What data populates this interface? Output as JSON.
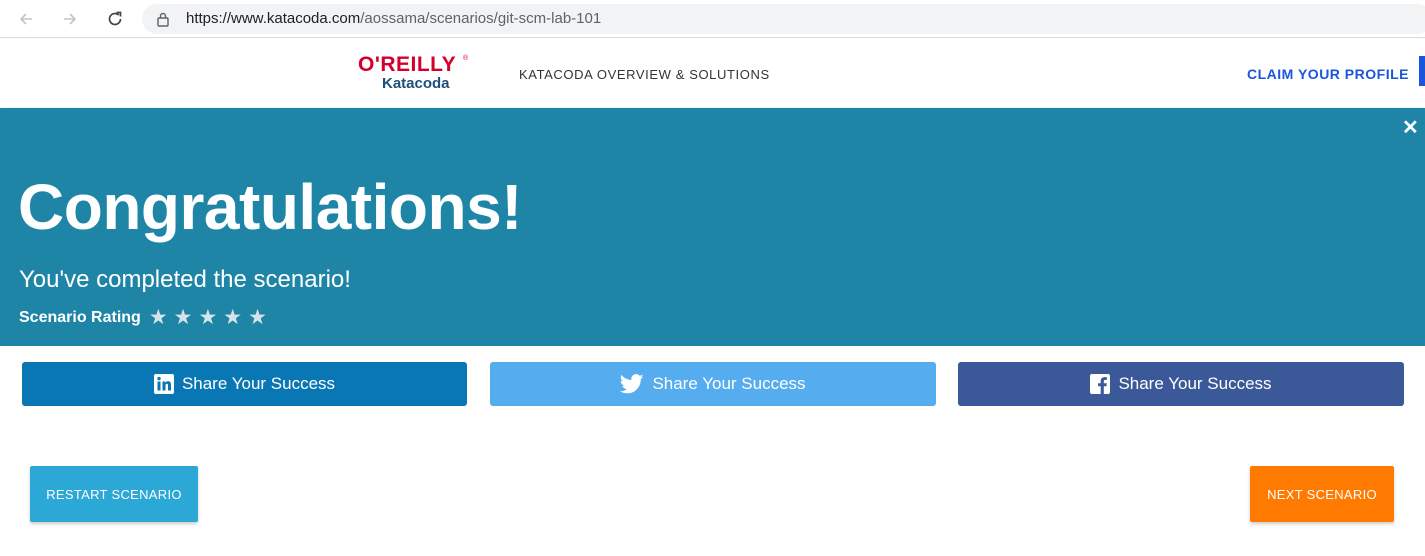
{
  "browser": {
    "url_host": "https://www.katacoda.com",
    "url_path": "/aossama/scenarios/git-scm-lab-101"
  },
  "header": {
    "logo_top": "O'REILLY",
    "logo_reg": "®",
    "logo_bottom": "Katacoda",
    "nav_overview": "KATACODA OVERVIEW & SOLUTIONS",
    "nav_claim": "CLAIM YOUR PROFILE"
  },
  "banner": {
    "close": "✕",
    "title": "Congratulations!",
    "subtitle": "You've completed the scenario!",
    "rating_label": "Scenario Rating",
    "rating_stars": 5,
    "star_glyph": "★"
  },
  "share": {
    "linkedin_label": "Share Your Success",
    "twitter_label": "Share Your Success",
    "facebook_label": "Share Your Success",
    "linkedin_color": "#0a77b5",
    "twitter_color": "#55acee",
    "facebook_color": "#3b5998"
  },
  "actions": {
    "restart_label": "RESTART SCENARIO",
    "next_label": "NEXT SCENARIO",
    "restart_color": "#2ba8d6",
    "next_color": "#ff7a00"
  },
  "colors": {
    "banner": "#1f85a7",
    "brand_red": "#d3002d",
    "link_blue": "#1a56db"
  }
}
